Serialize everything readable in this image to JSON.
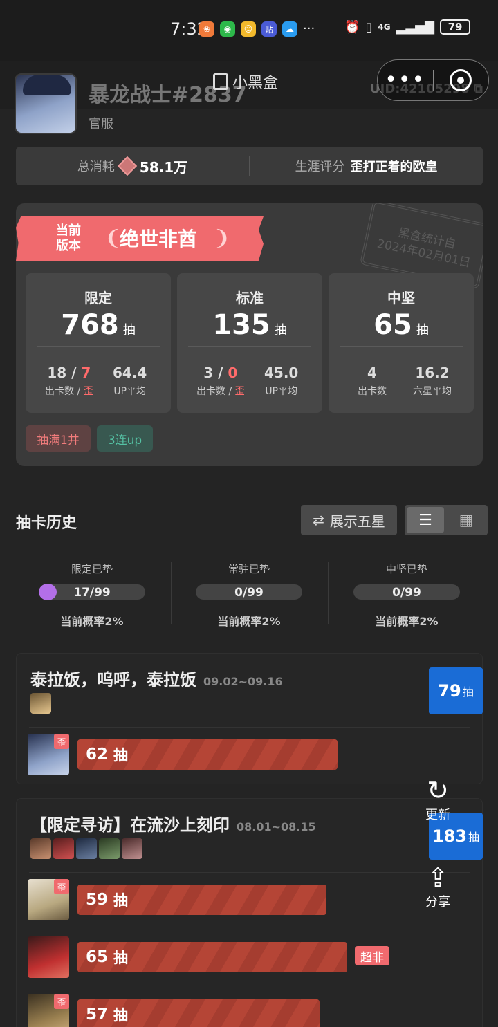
{
  "status_bar": {
    "time": "7:32",
    "network": "4G",
    "battery": "79",
    "more": "···"
  },
  "header": {
    "username": "暴龙战士#2837",
    "server": "官服",
    "uid": "UID:42105298",
    "brand": "小黑盒"
  },
  "summary": {
    "total_label": "总消耗",
    "total_value": "58.1万",
    "career_label": "生涯评分",
    "career_value": "歪打正着的欧皇"
  },
  "version_card": {
    "ribbon_small": "当前\n版本",
    "ribbon_title": "绝世非酋",
    "stamp": "黑盒统计自\n2024年02月01日",
    "boxes": [
      {
        "title": "限定",
        "count": "768",
        "unit": "抽",
        "stat1_value": "18 / ",
        "stat1_value_red": "7",
        "stat1_label": "出卡数 / ",
        "stat1_label_red": "歪",
        "stat2_value": "64.4",
        "stat2_label": "UP平均"
      },
      {
        "title": "标准",
        "count": "135",
        "unit": "抽",
        "stat1_value": "3 / ",
        "stat1_value_red": "0",
        "stat1_label": "出卡数 / ",
        "stat1_label_red": "歪",
        "stat2_value": "45.0",
        "stat2_label": "UP平均"
      },
      {
        "title": "中坚",
        "count": "65",
        "unit": "抽",
        "stat1_value": "4",
        "stat1_value_red": "",
        "stat1_label": "出卡数",
        "stat1_label_red": "",
        "stat2_value": "16.2",
        "stat2_label": "六星平均"
      }
    ],
    "tags": [
      "抽满1井",
      "3连up"
    ]
  },
  "history": {
    "title": "抽卡历史",
    "toggle_label": "展示五星",
    "pity": [
      {
        "label": "限定已垫",
        "value": "17/99",
        "rate": "当前概率2%"
      },
      {
        "label": "常驻已垫",
        "value": "0/99",
        "rate": "当前概率2%"
      },
      {
        "label": "中坚已垫",
        "value": "0/99",
        "rate": "当前概率2%"
      }
    ]
  },
  "banners": [
    {
      "name": "泰拉饭，呜呼，泰拉饭",
      "date": "09.02~09.16",
      "badge_count": "79",
      "badge_unit": "抽",
      "pulls": [
        {
          "count": "62",
          "unit": "抽",
          "tag": "歪"
        }
      ]
    },
    {
      "name": "【限定寻访】在流沙上刻印",
      "date": "08.01~08.15",
      "badge_count": "183",
      "badge_unit": "抽",
      "pulls": [
        {
          "count": "59",
          "unit": "抽",
          "tag": "歪"
        },
        {
          "count": "65",
          "unit": "抽",
          "tag": "",
          "extra": "超非"
        },
        {
          "count": "57",
          "unit": "抽",
          "tag": "歪"
        }
      ]
    }
  ],
  "fab": {
    "refresh": "更新",
    "share": "分享"
  },
  "colors": {
    "accent_red": "#f06a6e",
    "accent_blue": "#1a6cd6",
    "pity_purple": "#b36fe8"
  }
}
